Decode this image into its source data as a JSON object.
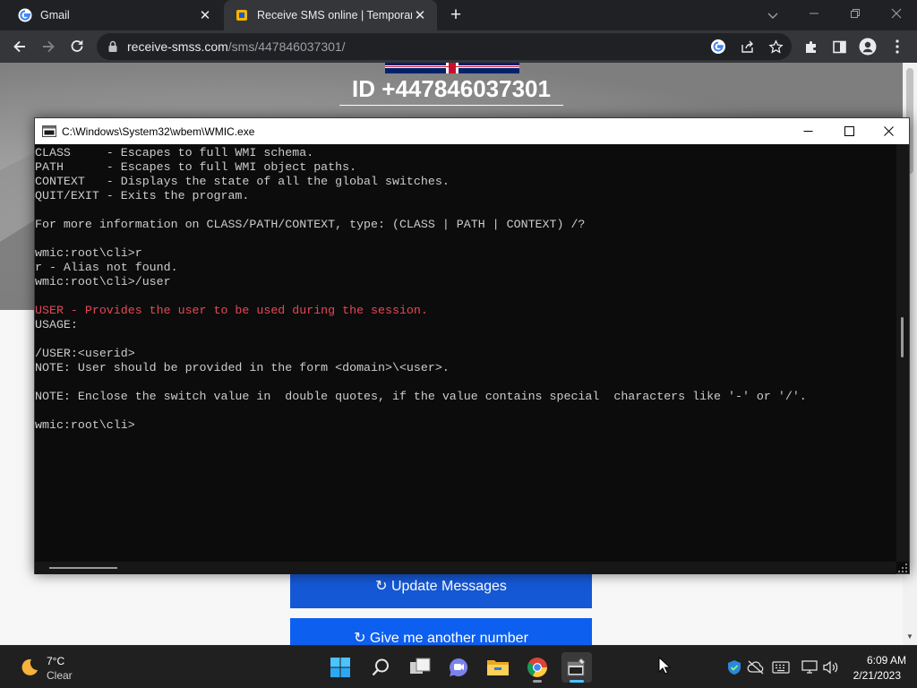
{
  "browser": {
    "tabs": [
      {
        "title": "Gmail",
        "state": "inactive"
      },
      {
        "title": "Receive SMS online | Temporary",
        "state": "active"
      }
    ],
    "url_host": "receive-smss.com",
    "url_path": "/sms/447846037301/"
  },
  "webpage": {
    "phone_id": "ID +447846037301",
    "update_button": "↻ Update Messages",
    "another_button": "↻ Give me another number"
  },
  "console": {
    "title": "C:\\Windows\\System32\\wbem\\WMIC.exe",
    "lines": [
      {
        "text": "CLASS     - Escapes to full WMI schema.",
        "color": "normal"
      },
      {
        "text": "PATH      - Escapes to full WMI object paths.",
        "color": "normal"
      },
      {
        "text": "CONTEXT   - Displays the state of all the global switches.",
        "color": "normal"
      },
      {
        "text": "QUIT/EXIT - Exits the program.",
        "color": "normal"
      },
      {
        "text": "",
        "color": "normal"
      },
      {
        "text": "For more information on CLASS/PATH/CONTEXT, type: (CLASS | PATH | CONTEXT) /?",
        "color": "normal"
      },
      {
        "text": "",
        "color": "normal"
      },
      {
        "text": "wmic:root\\cli>r",
        "color": "normal"
      },
      {
        "text": "r - Alias not found.",
        "color": "normal"
      },
      {
        "text": "wmic:root\\cli>/user",
        "color": "normal"
      },
      {
        "text": "",
        "color": "normal"
      },
      {
        "text": "USER - Provides the user to be used during the session.",
        "color": "red"
      },
      {
        "text": "USAGE:",
        "color": "normal"
      },
      {
        "text": "",
        "color": "normal"
      },
      {
        "text": "/USER:<userid>",
        "color": "normal"
      },
      {
        "text": "NOTE: User should be provided in the form <domain>\\<user>.",
        "color": "normal"
      },
      {
        "text": "",
        "color": "normal"
      },
      {
        "text": "NOTE: Enclose the switch value in  double quotes, if the value contains special  characters like '-' or '/'.",
        "color": "normal"
      },
      {
        "text": "",
        "color": "normal"
      },
      {
        "text": "wmic:root\\cli>",
        "color": "normal"
      }
    ]
  },
  "taskbar": {
    "weather_temp": "7°C",
    "weather_desc": "Clear",
    "time": "6:09 AM",
    "date": "2/21/2023",
    "apps": [
      "start-icon",
      "search-icon",
      "task-view-icon",
      "teams-chat-icon",
      "file-explorer-icon",
      "chrome-icon",
      "wmic-console-icon"
    ]
  },
  "colors": {
    "console_bg": "#0c0c0c",
    "console_text": "#cccccc",
    "console_highlight": "#e74856",
    "update_button": "#1558d6",
    "another_button": "#0d5ff0",
    "taskbar_bg": "#202020"
  }
}
